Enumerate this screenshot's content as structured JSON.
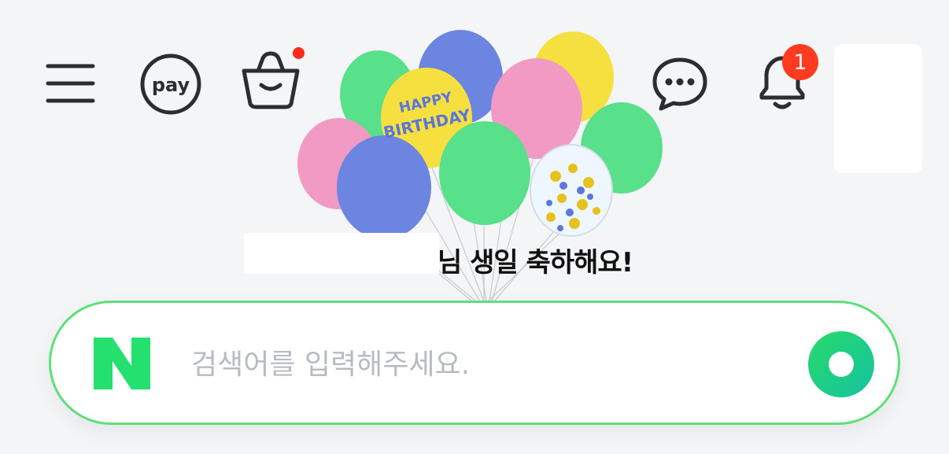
{
  "header": {
    "icons": {
      "menu": "hamburger-menu-icon",
      "pay": "pay-icon",
      "cart": "shopping-bag-icon",
      "chat": "chat-bubble-icon",
      "notifications": "bell-icon"
    },
    "pay_label": "pay",
    "notification_count": "1"
  },
  "birthday": {
    "balloon_text_line1": "HAPPY",
    "balloon_text_line2": "BIRTHDAY",
    "greeting": "님 생일 축하해요!"
  },
  "search": {
    "logo": "N",
    "placeholder": "검색어를 입력해주세요.",
    "value": ""
  },
  "colors": {
    "brand_green": "#03c75a",
    "search_border": "#5ee07a",
    "badge_red": "#ff3b1f",
    "background": "#f4f5f7"
  }
}
